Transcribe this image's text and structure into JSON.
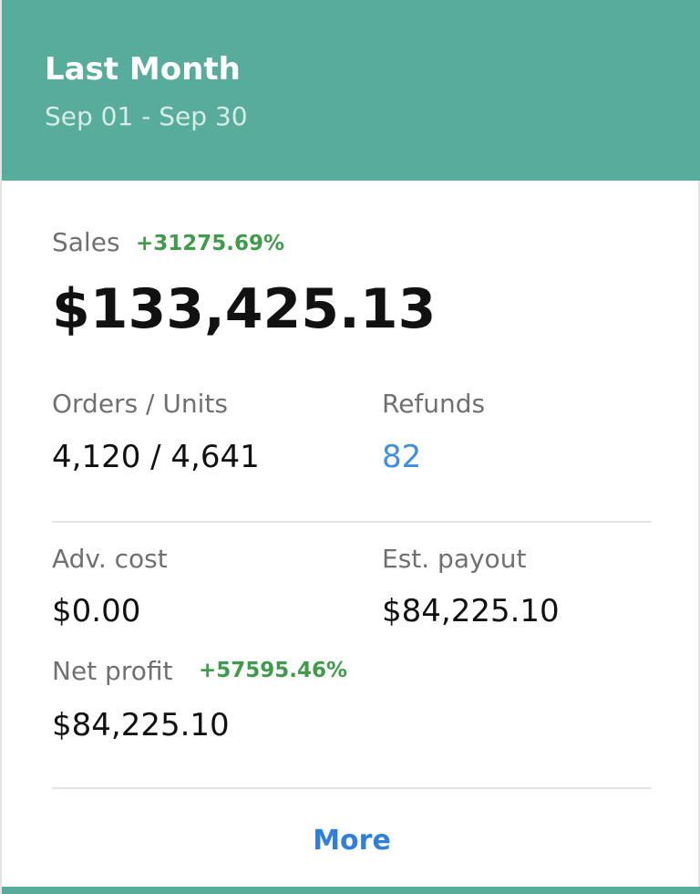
{
  "header": {
    "title": "Last Month",
    "range": "Sep 01 - Sep 30"
  },
  "sales": {
    "label": "Sales",
    "delta": "+31275.69%",
    "value": "$133,425.13"
  },
  "orders_units": {
    "label": "Orders / Units",
    "value": "4,120 / 4,641"
  },
  "refunds": {
    "label": "Refunds",
    "value": "82"
  },
  "adv_cost": {
    "label": "Adv. cost",
    "value": "$0.00"
  },
  "est_payout": {
    "label": "Est. payout",
    "value": "$84,225.10"
  },
  "net_profit": {
    "label": "Net profit",
    "delta": "+57595.46%",
    "value": "$84,225.10"
  },
  "more": {
    "label": "More"
  },
  "colors": {
    "header_bg": "#58ac9b",
    "positive_delta": "#3f9c4a",
    "link": "#2f7fdc"
  }
}
